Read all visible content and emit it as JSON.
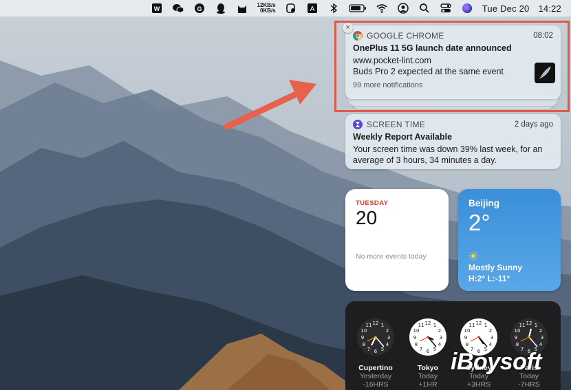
{
  "menubar": {
    "net_up": "12KB/s",
    "net_down": "0KB/s",
    "date": "Tue Dec 20",
    "time": "14:22",
    "icons": [
      "wps-icon",
      "wechat-icon",
      "grammarly-icon",
      "qq-icon",
      "cat-icon",
      "net-speed",
      "clipboard-icon",
      "input-source-icon",
      "bluetooth-icon",
      "battery-icon",
      "wifi-icon",
      "user-icon",
      "search-icon",
      "control-center-icon",
      "siri-icon"
    ]
  },
  "notifications": [
    {
      "app": "GOOGLE CHROME",
      "time": "08:02",
      "title": "OnePlus 11 5G launch date announced",
      "line1": "www.pocket-lint.com",
      "line2": "Buds Pro 2 expected at the same event",
      "more": "99 more notifications",
      "icon": "chrome-icon"
    },
    {
      "app": "SCREEN TIME",
      "time": "2 days ago",
      "title": "Weekly Report Available",
      "body": "Your screen time was down 39% last week, for an average of 3 hours, 34 minutes a day.",
      "icon": "screen-time-icon"
    }
  ],
  "calendar": {
    "day": "TUESDAY",
    "date": "20",
    "empty": "No more events today"
  },
  "weather": {
    "city": "Beijing",
    "temp": "2°",
    "condition": "Mostly Sunny",
    "range": "H:2° L:-11°"
  },
  "world_clock": [
    {
      "city": "Cupertino",
      "day": "Yesterday",
      "offset": "-16HRS",
      "face": "dark"
    },
    {
      "city": "Tokyo",
      "day": "Today",
      "offset": "+1HR",
      "face": "light"
    },
    {
      "city": "Sydney",
      "day": "Today",
      "offset": "+3HRS",
      "face": "light"
    },
    {
      "city": "Paris",
      "day": "Today",
      "offset": "-7HRS",
      "face": "dark"
    }
  ],
  "watermark": "iBoysoft",
  "colors": {
    "highlight": "#e05a4a",
    "arrow": "#e8614c",
    "calendar_red": "#e0362b",
    "weather_blue": "#3a8fd9"
  }
}
